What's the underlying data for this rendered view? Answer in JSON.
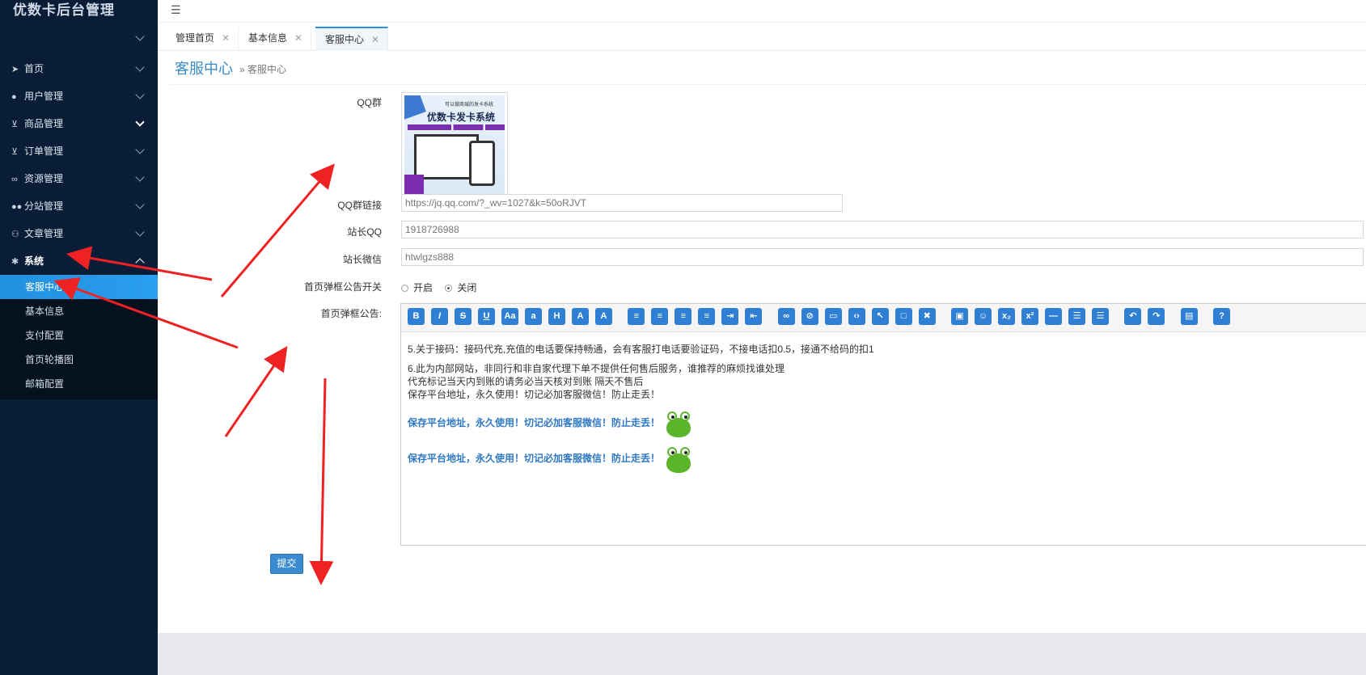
{
  "sidebar": {
    "brand": "优数卡后台管理",
    "items": [
      {
        "label": "首页",
        "icon": "paper-plane-icon"
      },
      {
        "label": "用户管理",
        "icon": "user-icon"
      },
      {
        "label": "商品管理",
        "icon": "cart-icon"
      },
      {
        "label": "订单管理",
        "icon": "cart-icon"
      },
      {
        "label": "资源管理",
        "icon": "link-icon"
      },
      {
        "label": "分站管理",
        "icon": "users-icon"
      },
      {
        "label": "文章管理",
        "icon": "binoculars-icon"
      },
      {
        "label": "系统",
        "icon": "gear-icon"
      }
    ],
    "submenu": [
      "客服中心",
      "基本信息",
      "支付配置",
      "首页轮播图",
      "邮箱配置"
    ]
  },
  "tabs": [
    {
      "label": "管理首页"
    },
    {
      "label": "基本信息"
    },
    {
      "label": "客服中心"
    }
  ],
  "page": {
    "title": "客服中心",
    "breadcrumb": "» 客服中心"
  },
  "form": {
    "qq_group_label": "QQ群",
    "qq_image": {
      "title": "优数卡发卡系统",
      "subtitle": "可以做商城的发卡系统"
    },
    "qq_link_label": "QQ群链接",
    "qq_link_value": "https://jq.qq.com/?_wv=1027&k=50oRJVT",
    "owner_qq_label": "站长QQ",
    "owner_qq_value": "1918726988",
    "owner_wechat_label": "站长微信",
    "owner_wechat_value": "htwlgzs888",
    "popup_switch_label": "首页弹框公告开关",
    "popup_on": "开启",
    "popup_off": "关闭",
    "popup_selected": "关闭",
    "popup_notice_label": "首页弹框公告:",
    "editor_content": {
      "p1": "5.关于接码：接码代充,充值的电话要保持畅通，会有客服打电话要验证码，不接电话扣0.5，接通不给码的扣1",
      "p2": "6.此为内部网站，非同行和非自家代理下单不提供任何售后服务，谁推荐的麻烦找谁处理",
      "p3": "代充标记当天内到账的请务必当天核对到账 隔天不售后",
      "p4": "保存平台地址，永久使用！切记必加客服微信！防止走丢！",
      "blue1": "保存平台地址，永久使用！切记必加客服微信！防止走丢！",
      "blue2": "保存平台地址，永久使用！切记必加客服微信！防止走丢！"
    },
    "submit_label": "提交"
  },
  "colors": {
    "sidebar_bg": "#091d37",
    "active_sub": "#2190de",
    "accent": "#3a8bc8",
    "toolbar_button": "#2f7fd4",
    "annotation_arrow": "#ee2222"
  }
}
